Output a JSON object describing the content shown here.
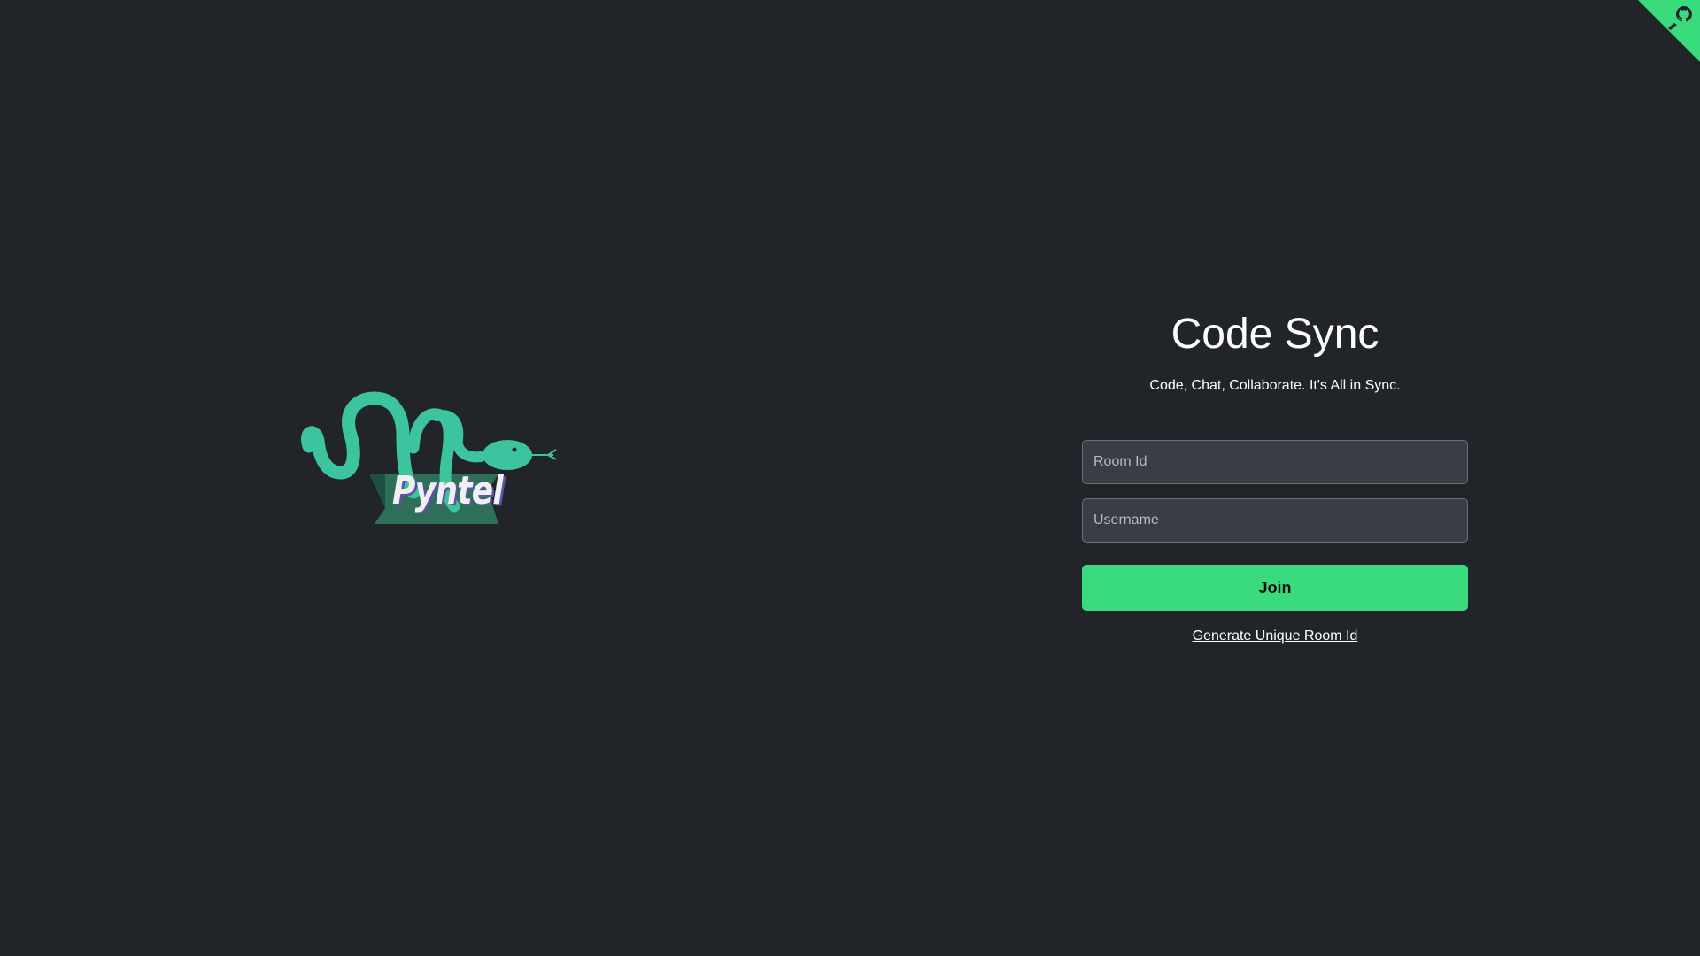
{
  "corner": {
    "icon": "github-octocat-icon",
    "color": "#39db7c"
  },
  "logo": {
    "wordmark": "Pyntel",
    "color": "#3cc49f"
  },
  "form": {
    "title": "Code Sync",
    "subtitle": "Code, Chat, Collaborate. It's All in Sync.",
    "room_id_placeholder": "Room Id",
    "username_placeholder": "Username",
    "join_label": "Join",
    "generate_label": "Generate Unique Room Id"
  },
  "colors": {
    "background": "#212429",
    "accent": "#39db7c",
    "input_bg": "#3a3d46"
  }
}
